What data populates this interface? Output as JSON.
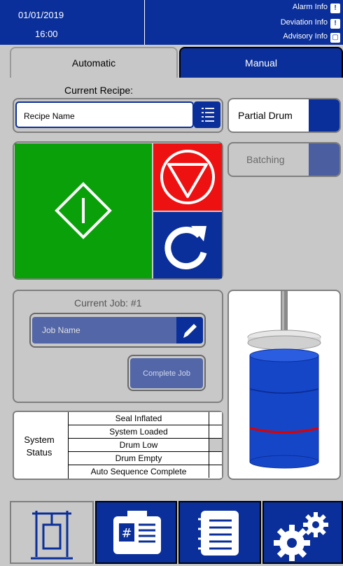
{
  "header": {
    "date": "01/01/2019",
    "time": "16:00",
    "alarm_info": "Alarm Info",
    "deviation_info": "Deviation Info",
    "advisory_info": "Advisory Info"
  },
  "tabs": [
    {
      "label": "Automatic",
      "active": true
    },
    {
      "label": "Manual",
      "active": false
    }
  ],
  "recipe": {
    "heading": "Current Recipe:",
    "name": "Recipe Name"
  },
  "partial_drum": {
    "label": "Partial Drum"
  },
  "batching": {
    "label": "Batching"
  },
  "job": {
    "heading": "Current Job: #1",
    "name": "Job Name",
    "complete_label": "Complete Job"
  },
  "system_status": {
    "title_line1": "System",
    "title_line2": "Status",
    "items": [
      {
        "label": "Seal Inflated",
        "indicator": "off"
      },
      {
        "label": "System Loaded",
        "indicator": "off"
      },
      {
        "label": "Drum Low",
        "indicator": "grey"
      },
      {
        "label": "Drum Empty",
        "indicator": "off"
      },
      {
        "label": "Auto Sequence Complete",
        "indicator": "off"
      }
    ]
  },
  "colors": {
    "primary_blue": "#0a2f9a",
    "start_green": "#0aa00a",
    "stop_red": "#ee1111",
    "background": "#c8c8c8"
  },
  "icons": {
    "start": "start-diamond-icon",
    "stop": "stop-triangle-icon",
    "reset": "reset-arrow-icon",
    "recipe_list": "list-icon",
    "edit": "pencil-icon",
    "nav": [
      "machine-icon",
      "control-panel-icon",
      "notebook-icon",
      "gears-icon"
    ]
  }
}
